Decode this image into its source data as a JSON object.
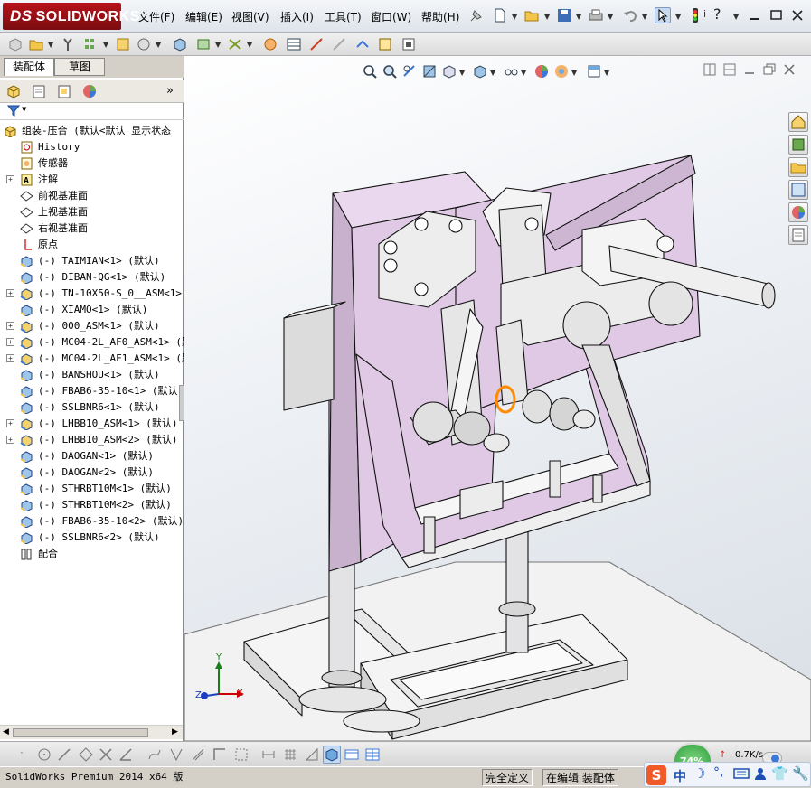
{
  "app": {
    "logo_text": "SOLIDWORKS",
    "brand_color": "#b7121a"
  },
  "menu": [
    {
      "label": "文件(F)"
    },
    {
      "label": "编辑(E)"
    },
    {
      "label": "视图(V)"
    },
    {
      "label": "插入(I)"
    },
    {
      "label": "工具(T)"
    },
    {
      "label": "窗口(W)"
    },
    {
      "label": "帮助(H)"
    }
  ],
  "left_pane": {
    "tabs": [
      {
        "label": "装配体",
        "active": true
      },
      {
        "label": "草图",
        "active": false
      }
    ],
    "tree": [
      {
        "label": "组装-压合  (默认<默认_显示状态",
        "icon": "assembly-icon",
        "indent": 0,
        "expander": false
      },
      {
        "label": "History",
        "icon": "history-icon",
        "indent": 1,
        "expander": false
      },
      {
        "label": "传感器",
        "icon": "sensor-icon",
        "indent": 1,
        "expander": false
      },
      {
        "label": "注解",
        "icon": "annotation-icon",
        "indent": 1,
        "expander": true
      },
      {
        "label": "前视基准面",
        "icon": "plane-icon",
        "indent": 1,
        "expander": false
      },
      {
        "label": "上视基准面",
        "icon": "plane-icon",
        "indent": 1,
        "expander": false
      },
      {
        "label": "右视基准面",
        "icon": "plane-icon",
        "indent": 1,
        "expander": false
      },
      {
        "label": "原点",
        "icon": "origin-icon",
        "indent": 1,
        "expander": false
      },
      {
        "label": "(-) TAIMIAN<1> (默认)",
        "icon": "part-icon",
        "indent": 1,
        "expander": false
      },
      {
        "label": "(-) DIBAN-QG<1> (默认)",
        "icon": "part-icon",
        "indent": 1,
        "expander": false
      },
      {
        "label": "(-) TN-10X50-S_0__ASM<1> (",
        "icon": "subassembly-icon",
        "indent": 1,
        "expander": true
      },
      {
        "label": "(-) XIAMO<1> (默认)",
        "icon": "part-icon",
        "indent": 1,
        "expander": false
      },
      {
        "label": "(-) 000_ASM<1> (默认)",
        "icon": "subassembly-icon",
        "indent": 1,
        "expander": true
      },
      {
        "label": "(-) MC04-2L_AF0_ASM<1> (默",
        "icon": "subassembly-icon",
        "indent": 1,
        "expander": true
      },
      {
        "label": "(-) MC04-2L_AF1_ASM<1> (默",
        "icon": "subassembly-icon",
        "indent": 1,
        "expander": true
      },
      {
        "label": "(-) BANSHOU<1> (默认)",
        "icon": "part-icon",
        "indent": 1,
        "expander": false
      },
      {
        "label": "(-) FBAB6-35-10<1> (默认)",
        "icon": "part-icon",
        "indent": 1,
        "expander": false
      },
      {
        "label": "(-) SSLBNR6<1> (默认)",
        "icon": "part-icon",
        "indent": 1,
        "expander": false
      },
      {
        "label": "(-) LHBB10_ASM<1> (默认)",
        "icon": "subassembly-icon",
        "indent": 1,
        "expander": true
      },
      {
        "label": "(-) LHBB10_ASM<2> (默认)",
        "icon": "subassembly-icon",
        "indent": 1,
        "expander": true
      },
      {
        "label": "(-) DAOGAN<1> (默认)",
        "icon": "part-icon",
        "indent": 1,
        "expander": false
      },
      {
        "label": "(-) DAOGAN<2> (默认)",
        "icon": "part-icon",
        "indent": 1,
        "expander": false
      },
      {
        "label": "(-) STHRBT10M<1> (默认)",
        "icon": "part-icon",
        "indent": 1,
        "expander": false
      },
      {
        "label": "(-) STHRBT10M<2> (默认)",
        "icon": "part-icon",
        "indent": 1,
        "expander": false
      },
      {
        "label": "(-) FBAB6-35-10<2> (默认)",
        "icon": "part-icon",
        "indent": 1,
        "expander": false
      },
      {
        "label": "(-) SSLBNR6<2> (默认)",
        "icon": "part-icon",
        "indent": 1,
        "expander": false
      },
      {
        "label": "配合",
        "icon": "mates-icon",
        "indent": 1,
        "expander": false
      }
    ]
  },
  "viewport": {
    "model_color": "#e0cde4",
    "triad": {
      "x": "X",
      "y": "Y",
      "z": "Z"
    }
  },
  "tray": {
    "percent": "74%",
    "net_speed": "0.7K/s",
    "ime_label": "中"
  },
  "status": {
    "product": "SolidWorks Premium 2014 x64 版",
    "state": "完全定义",
    "editing": "在编辑 装配体"
  }
}
